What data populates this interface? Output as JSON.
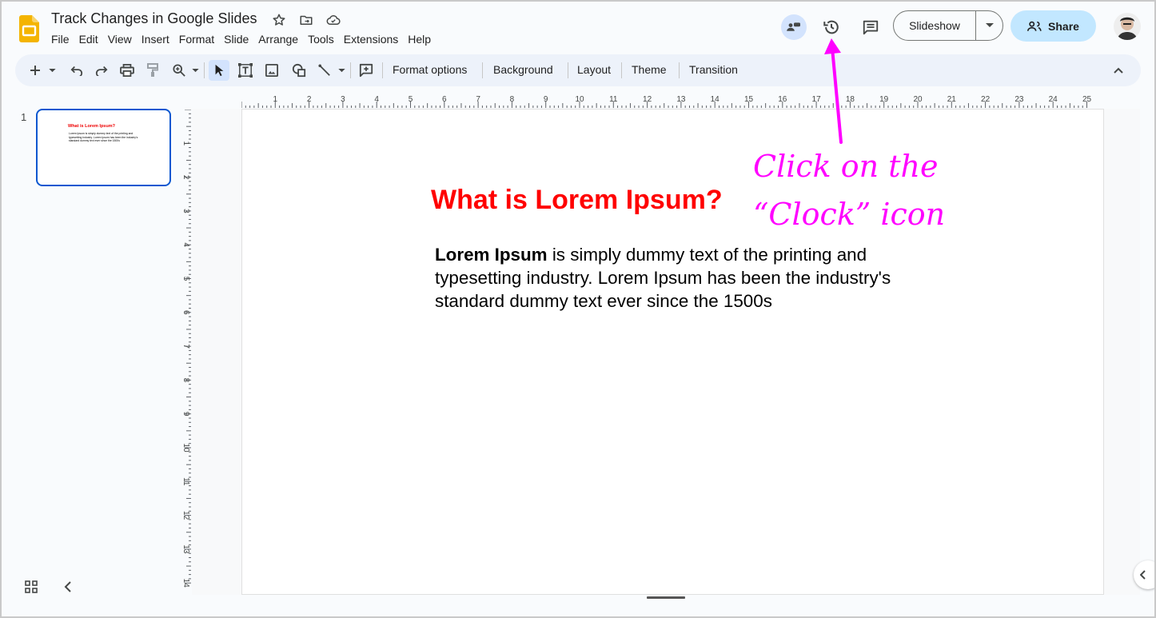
{
  "doc": {
    "title": "Track Changes in Google Slides"
  },
  "menu": [
    "File",
    "Edit",
    "View",
    "Insert",
    "Format",
    "Slide",
    "Arrange",
    "Tools",
    "Extensions",
    "Help"
  ],
  "header": {
    "slideshow_label": "Slideshow",
    "share_label": "Share"
  },
  "toolbar": {
    "format_options": "Format options",
    "background": "Background",
    "layout": "Layout",
    "theme": "Theme",
    "transition": "Transition"
  },
  "filmstrip": {
    "slide_number": "1",
    "thumb_title": "What is Lorem Ipsum?",
    "thumb_body": "Lorem Ipsum is simply dummy text of the printing and typesetting industry. Lorem Ipsum has been the industry's standard dummy text ever since the 1500s"
  },
  "slide": {
    "title": "What is Lorem Ipsum?",
    "body_bold": "Lorem Ipsum",
    "body_rest": " is simply dummy text of the printing and typesetting industry. Lorem Ipsum has been the industry's standard dummy text ever since the 1500s"
  },
  "ruler": {
    "h_labels": [
      "1",
      "2",
      "3",
      "4",
      "5",
      "6",
      "7",
      "8",
      "9",
      "10",
      "11",
      "12",
      "13",
      "14",
      "15",
      "16",
      "17",
      "18",
      "19",
      "20",
      "21",
      "22",
      "23",
      "24",
      "25"
    ],
    "v_labels": [
      "1",
      "2",
      "3",
      "4",
      "5",
      "6",
      "7",
      "8",
      "9",
      "10",
      "11",
      "12",
      "13",
      "14"
    ]
  },
  "annotation": {
    "line1": "Click on the",
    "line2": "“Clock” icon"
  },
  "colors": {
    "accent": "#0b57d0",
    "share_bg": "#c2e7ff",
    "title_red": "#ff0000",
    "annotation": "#ff00ff",
    "toolbar_bg": "#edf2fa"
  },
  "icons": [
    "slides-logo",
    "star-icon",
    "move-folder-icon",
    "cloud-saved-icon",
    "meet-icon",
    "history-clock-icon",
    "comments-icon",
    "chevron-down-icon",
    "share-person-icon",
    "new-slide-icon",
    "undo-icon",
    "redo-icon",
    "print-icon",
    "paint-format-icon",
    "zoom-icon",
    "select-icon",
    "text-box-icon",
    "image-icon",
    "shape-icon",
    "line-icon",
    "comment-add-icon",
    "collapse-icon",
    "grid-view-icon",
    "chevron-left-icon"
  ]
}
